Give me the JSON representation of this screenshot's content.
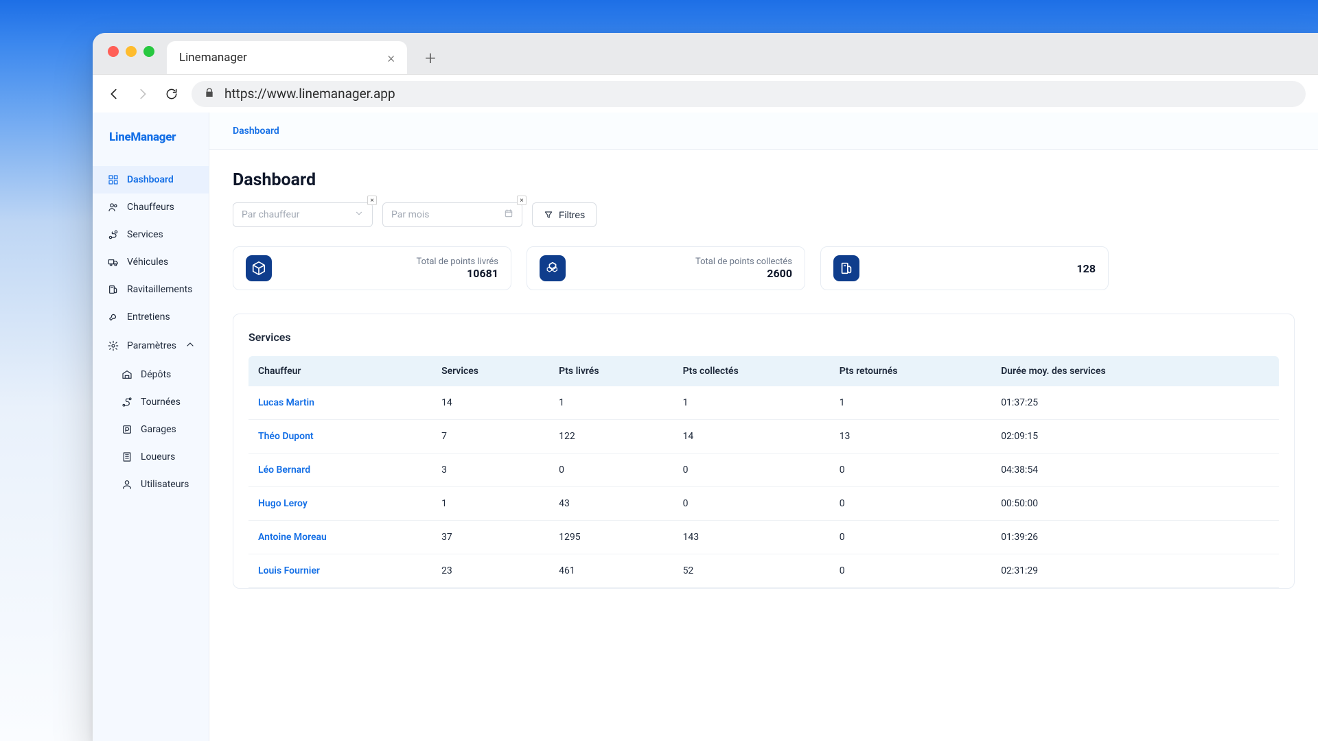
{
  "browser": {
    "tab_title": "Linemanager",
    "url": "https://www.linemanager.app"
  },
  "app": {
    "logo": "LineManager",
    "breadcrumb": "Dashboard",
    "page_title": "Dashboard"
  },
  "sidebar": {
    "items": [
      {
        "label": "Dashboard"
      },
      {
        "label": "Chauffeurs"
      },
      {
        "label": "Services"
      },
      {
        "label": "Véhicules"
      },
      {
        "label": "Ravitaillements"
      },
      {
        "label": "Entretiens"
      },
      {
        "label": "Paramètres"
      }
    ],
    "subitems": [
      {
        "label": "Dépôts"
      },
      {
        "label": "Tournées"
      },
      {
        "label": "Garages"
      },
      {
        "label": "Loueurs"
      },
      {
        "label": "Utilisateurs"
      }
    ]
  },
  "filters": {
    "driver_placeholder": "Par chauffeur",
    "month_placeholder": "Par mois",
    "button": "Filtres"
  },
  "cards": [
    {
      "label": "Total de points livrés",
      "value": "10681"
    },
    {
      "label": "Total de points collectés",
      "value": "2600"
    },
    {
      "label": "",
      "value": "128"
    }
  ],
  "table": {
    "title": "Services",
    "headers": [
      "Chauffeur",
      "Services",
      "Pts livrés",
      "Pts collectés",
      "Pts retournés",
      "Durée moy. des services"
    ],
    "rows": [
      {
        "name": "Lucas Martin",
        "services": "14",
        "livres": "1",
        "collectes": "1",
        "retournes": "1",
        "duree": "01:37:25"
      },
      {
        "name": "Théo Dupont",
        "services": "7",
        "livres": "122",
        "collectes": "14",
        "retournes": "13",
        "duree": "02:09:15"
      },
      {
        "name": "Léo Bernard",
        "services": "3",
        "livres": "0",
        "collectes": "0",
        "retournes": "0",
        "duree": "04:38:54"
      },
      {
        "name": "Hugo Leroy",
        "services": "1",
        "livres": "43",
        "collectes": "0",
        "retournes": "0",
        "duree": "00:50:00"
      },
      {
        "name": "Antoine Moreau",
        "services": "37",
        "livres": "1295",
        "collectes": "143",
        "retournes": "0",
        "duree": "01:39:26"
      },
      {
        "name": "Louis Fournier",
        "services": "23",
        "livres": "461",
        "collectes": "52",
        "retournes": "0",
        "duree": "02:31:29"
      }
    ]
  }
}
